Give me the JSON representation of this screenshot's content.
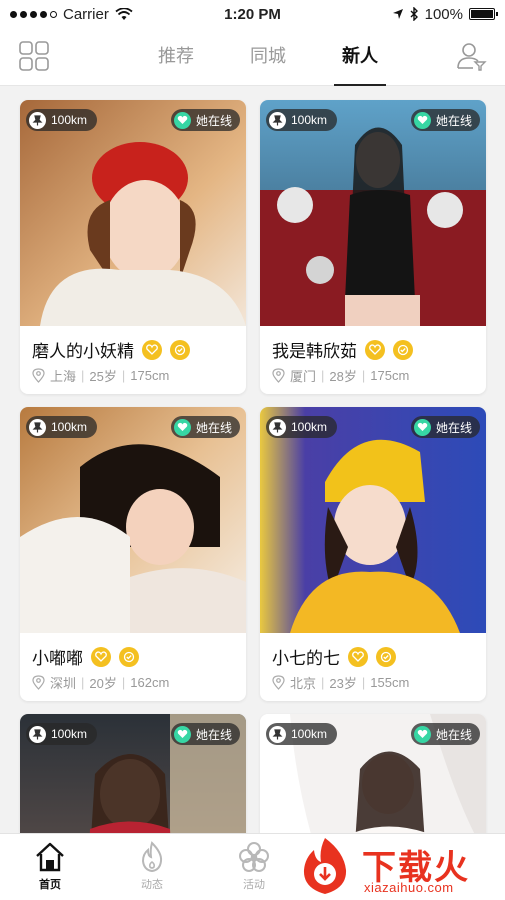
{
  "status_bar": {
    "carrier": "Carrier",
    "time": "1:20 PM",
    "battery": "100%"
  },
  "nav": {
    "tabs": [
      {
        "label": "推荐",
        "active": false
      },
      {
        "label": "同城",
        "active": false
      },
      {
        "label": "新人",
        "active": true
      }
    ]
  },
  "badges": {
    "online": "她在线"
  },
  "cards": [
    {
      "name": "磨人的小妖精",
      "distance": "100km",
      "city": "上海",
      "age": "25岁",
      "height": "175cm"
    },
    {
      "name": "我是韩欣茹",
      "distance": "100km",
      "city": "厦门",
      "age": "28岁",
      "height": "175cm"
    },
    {
      "name": "小嘟嘟",
      "distance": "100km",
      "city": "深圳",
      "age": "20岁",
      "height": "162cm"
    },
    {
      "name": "小七的七",
      "distance": "100km",
      "city": "北京",
      "age": "23岁",
      "height": "155cm"
    },
    {
      "name": "",
      "distance": "100km",
      "city": "",
      "age": "",
      "height": ""
    },
    {
      "name": "",
      "distance": "100km",
      "city": "",
      "age": "",
      "height": ""
    }
  ],
  "tabbar": [
    {
      "label": "首页",
      "icon": "home-icon",
      "active": true
    },
    {
      "label": "动态",
      "icon": "flame-icon",
      "active": false
    },
    {
      "label": "活动",
      "icon": "flower-icon",
      "active": false
    }
  ],
  "watermark": {
    "text": "下载火",
    "url": "xiazaihuo.com"
  },
  "colors": {
    "online": "#37d6a4",
    "vip": "#f4c020",
    "watermark": "#e8321f"
  }
}
